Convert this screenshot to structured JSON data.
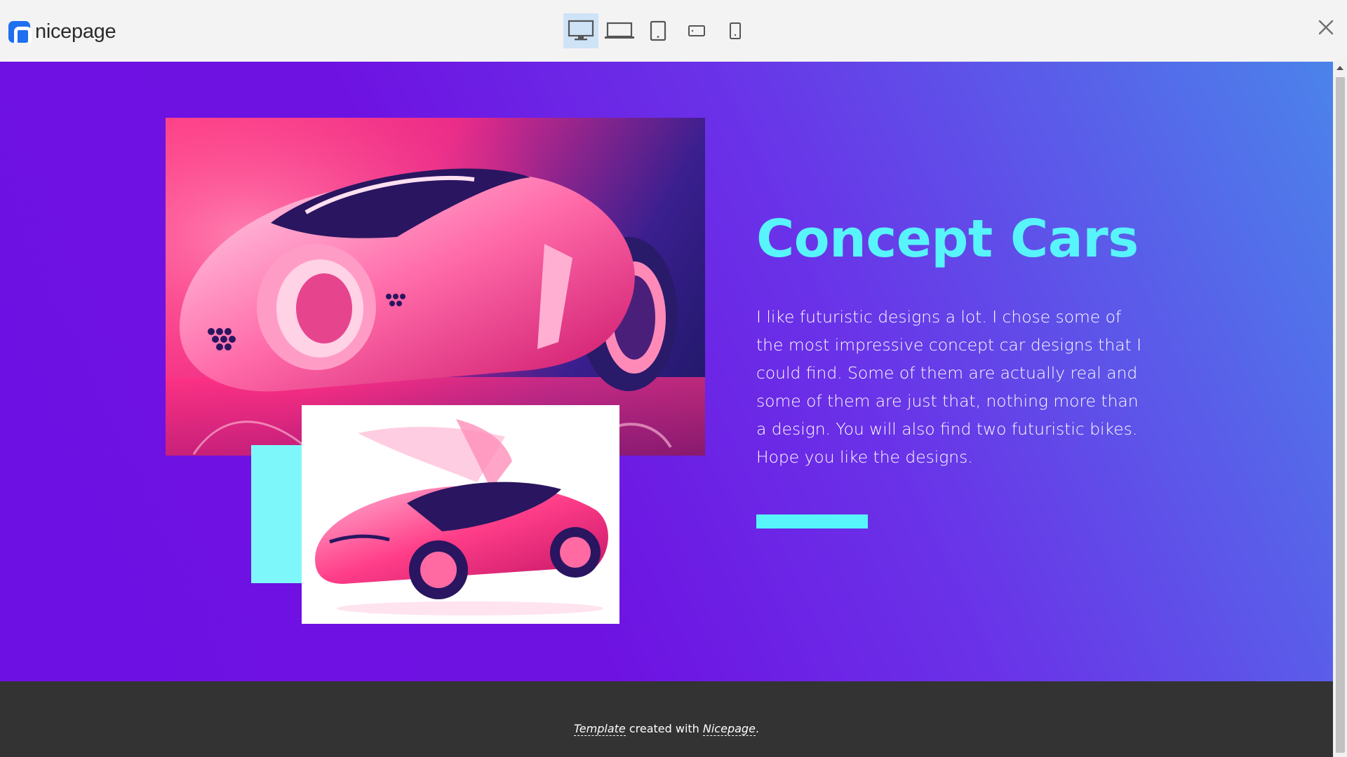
{
  "app": {
    "logo_text": "nicepage",
    "brand_color": "#1f6ff0"
  },
  "device_toolbar": {
    "items": [
      {
        "name": "desktop",
        "icon": "desktop-monitor-icon",
        "active": true
      },
      {
        "name": "laptop",
        "icon": "laptop-icon",
        "active": false
      },
      {
        "name": "tablet",
        "icon": "tablet-icon",
        "active": false
      },
      {
        "name": "phone-landscape",
        "icon": "phone-landscape-icon",
        "active": false
      },
      {
        "name": "phone-portrait",
        "icon": "phone-portrait-icon",
        "active": false
      }
    ],
    "active_color": "#cfe3f7"
  },
  "close_icon": "close-icon",
  "hero": {
    "title": "Concept Cars",
    "body": "I like futuristic designs a lot. I chose some of the most impressive concept car designs that I could find. Some of them are actually real and some of them are just that, nothing more than a design. You will also find two futuristic bikes. Hope you like the designs.",
    "accent_color": "#58f4fb",
    "background_gradient": [
      "#6d10e3",
      "#4b83ea"
    ],
    "images": [
      {
        "subject": "pink futuristic concept motorcycle"
      },
      {
        "subject": "pink concept car with gull-wing doors"
      }
    ]
  },
  "footer": {
    "link_template": "Template",
    "middle_text": " created with ",
    "link_nicepage": "Nicepage",
    "end_text": ".",
    "background": "#333333"
  }
}
